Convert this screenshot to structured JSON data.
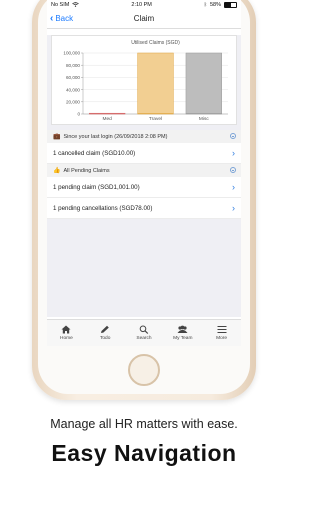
{
  "status": {
    "carrier": "No SIM",
    "time": "2:10 PM",
    "battery": "58%"
  },
  "nav": {
    "back_label": "Back",
    "title": "Claim"
  },
  "chart_data": {
    "type": "bar",
    "title": "Utilised Claims (SGD)",
    "categories": [
      "Med",
      "Travel",
      "Misc"
    ],
    "series": [
      {
        "values": [
          1001,
          100000,
          100000
        ]
      }
    ],
    "ylim": [
      0,
      100000
    ],
    "yticks": [
      "0",
      "20,000",
      "40,000",
      "60,000",
      "80,000",
      "100,000"
    ],
    "colors": [
      "#e9a7a7",
      "#f2cf92",
      "#bdbdbd"
    ],
    "line_colors": [
      "#d66a6a",
      "#e0a640",
      "#9a9a9a"
    ]
  },
  "sections": [
    {
      "header": "Since your last login (26/09/2018 2:08 PM)",
      "rows": [
        "1 cancelled claim (SGD10.00)"
      ]
    },
    {
      "header": "All Pending Claims",
      "rows": [
        "1 pending claim (SGD1,001.00)",
        "1 pending cancellations (SGD78.00)"
      ]
    }
  ],
  "tabs": [
    {
      "label": "Home",
      "icon": "home-icon"
    },
    {
      "label": "Todo",
      "icon": "pencil-icon"
    },
    {
      "label": "Search",
      "icon": "search-icon"
    },
    {
      "label": "My Team",
      "icon": "team-icon"
    },
    {
      "label": "More",
      "icon": "menu-icon"
    }
  ],
  "caption": {
    "line1": "Manage all HR matters with ease.",
    "line2": "Easy Navigation"
  }
}
